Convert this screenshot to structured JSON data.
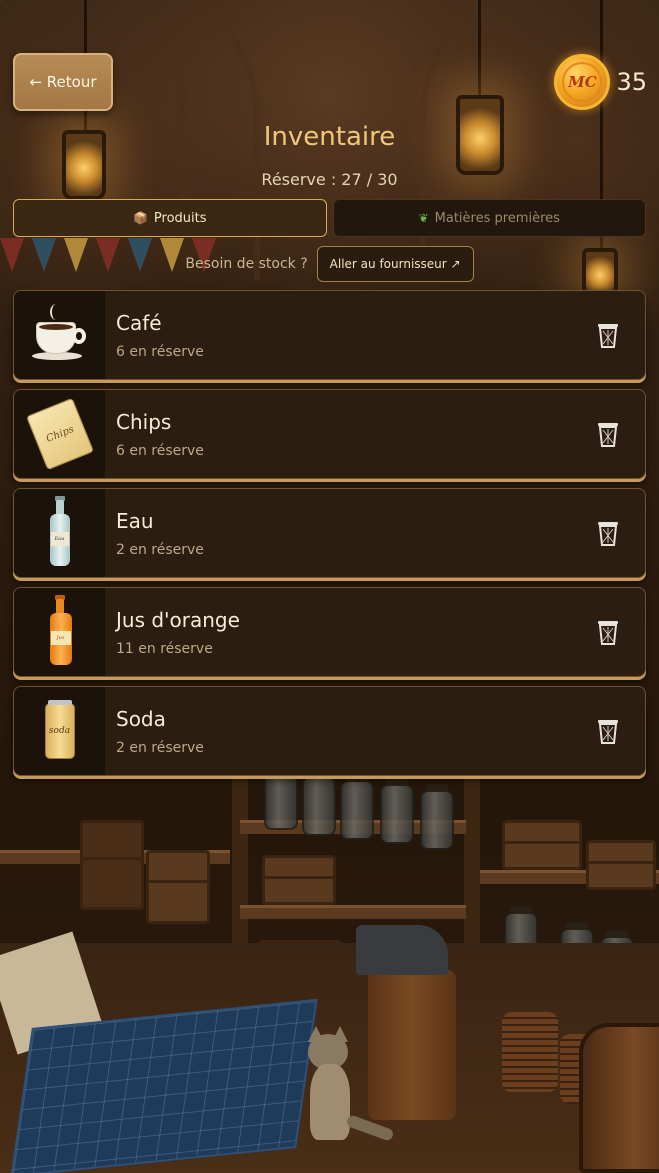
{
  "header": {
    "back_label": "← Retour",
    "coin_symbol": "MC",
    "coin_count": "35"
  },
  "page": {
    "title": "Inventaire",
    "reserve": "Réserve : 27 / 30"
  },
  "tabs": [
    {
      "label": "Produits",
      "icon": "box-icon",
      "active": true
    },
    {
      "label": "Matières premières",
      "icon": "leaf-icon",
      "active": false
    }
  ],
  "stock": {
    "question": "Besoin de stock ?",
    "supplier_label": "Aller au fournisseur ↗"
  },
  "items": [
    {
      "name": "Café",
      "qty": "6 en réserve",
      "icon": "coffee-cup-icon"
    },
    {
      "name": "Chips",
      "qty": "6 en réserve",
      "icon": "chips-bag-icon"
    },
    {
      "name": "Eau",
      "qty": "2 en réserve",
      "icon": "water-bottle-icon"
    },
    {
      "name": "Jus d'orange",
      "qty": "11 en réserve",
      "icon": "orange-juice-icon"
    },
    {
      "name": "Soda",
      "qty": "2 en réserve",
      "icon": "soda-can-icon"
    }
  ],
  "icon_labels": {
    "chips": "Chips",
    "water": "Eau",
    "juice": "Jus",
    "soda": "soda"
  },
  "colors": {
    "accent": "#f0c77a",
    "coin": "#f4a521",
    "panel": "#2b1d0f"
  }
}
